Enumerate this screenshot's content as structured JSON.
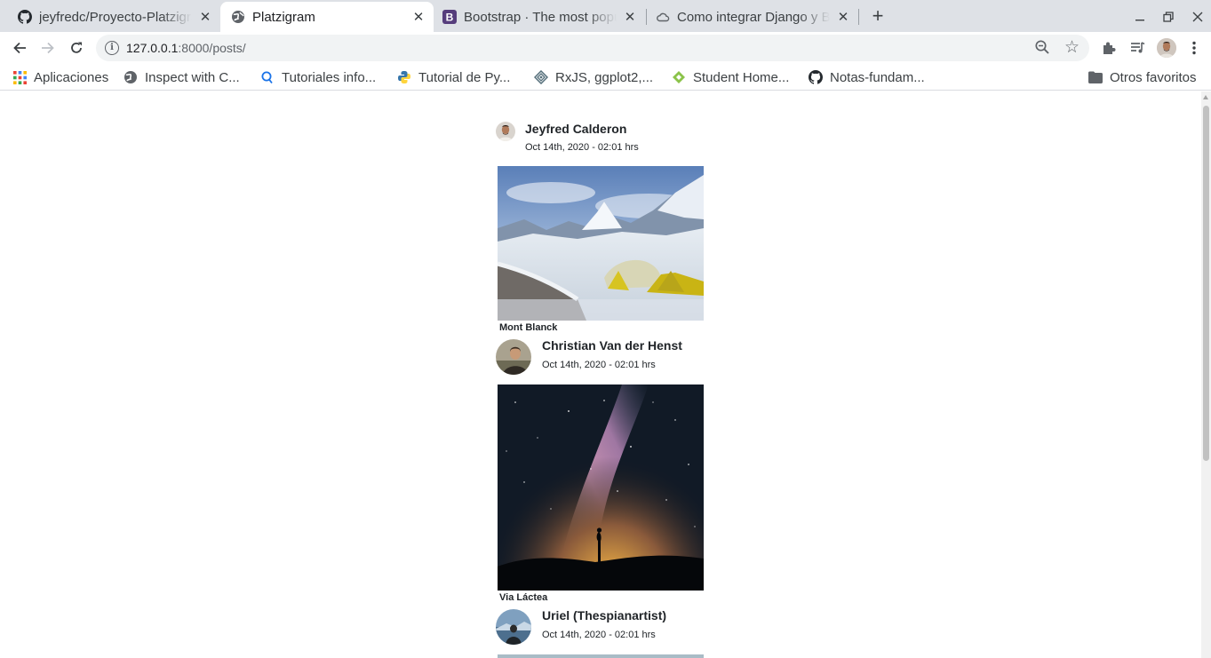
{
  "browser": {
    "tabs": [
      {
        "title": "jeyfredc/Proyecto-Platzigram",
        "icon": "github-icon",
        "active": false
      },
      {
        "title": "Platzigram",
        "icon": "globe-icon",
        "active": true
      },
      {
        "title": "Bootstrap · The most popular",
        "icon": "bootstrap-icon",
        "active": false
      },
      {
        "title": "Como integrar Django y Bootstrap",
        "icon": "cloud-icon",
        "active": false
      }
    ],
    "new_tab_label": "+",
    "url_host": "127.0.0.1",
    "url_rest": ":8000/posts/",
    "bookmarks": [
      {
        "label": "Aplicaciones",
        "icon": "apps-grid-icon"
      },
      {
        "label": "Inspect with C...",
        "icon": "globe-icon"
      },
      {
        "label": "Tutoriales info...",
        "icon": "tutoriales-icon"
      },
      {
        "label": "Tutorial de Py...",
        "icon": "python-icon"
      },
      {
        "label": "RxJS, ggplot2,...",
        "icon": "rxjs-icon"
      },
      {
        "label": "Student Home...",
        "icon": "student-icon"
      },
      {
        "label": "Notas-fundam...",
        "icon": "github-icon"
      }
    ],
    "other_bookmarks": "Otros favoritos",
    "colors": {
      "tabstrip": "#dee1e6",
      "accent": "#1a73e8"
    }
  },
  "feed": {
    "posts": [
      {
        "author": "Jeyfred Calderon",
        "date": "Oct 14th, 2020 - 02:01 hrs",
        "title": "Mont Blanck",
        "photo": "snowy-mountain-camp"
      },
      {
        "author": "Christian Van der Henst",
        "date": "Oct 14th, 2020 - 02:01 hrs",
        "title": "Via Láctea",
        "photo": "milky-way-night-sky"
      },
      {
        "author": "Uriel (Thespianartist)",
        "date": "Oct 14th, 2020 - 02:01 hrs",
        "title": "",
        "photo": "partial-photo"
      }
    ]
  }
}
